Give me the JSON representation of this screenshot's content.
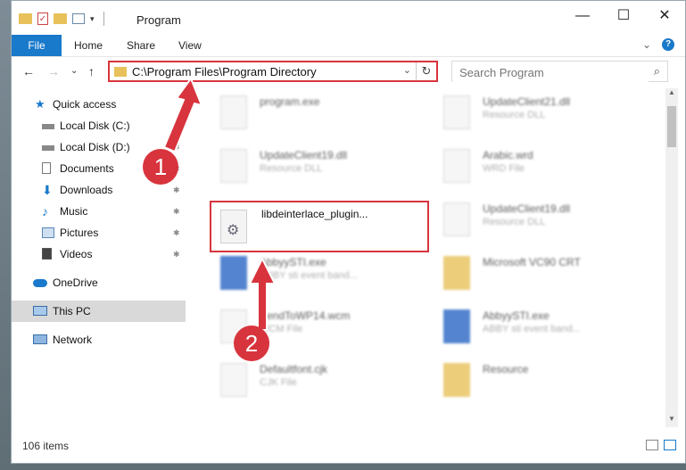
{
  "window": {
    "title": "Program",
    "controls": {
      "minimize": "—",
      "maximize": "☐",
      "close": "✕"
    }
  },
  "ribbon": {
    "tabs": [
      "File",
      "Home",
      "Share",
      "View"
    ],
    "expand": "⌄",
    "help": "?"
  },
  "nav": {
    "back": "←",
    "forward": "→",
    "recent": "⌄",
    "up": "↑",
    "address": "C:\\Program Files\\Program Directory",
    "refresh": "↻",
    "address_dropdown": "⌄"
  },
  "search": {
    "placeholder": "Search Program",
    "icon": "⌕"
  },
  "sidebar": {
    "items": [
      {
        "label": "Quick access",
        "icon": "star-icon",
        "pin": ""
      },
      {
        "label": "Local Disk (C:)",
        "icon": "drive-icon",
        "pin": ""
      },
      {
        "label": "Local Disk (D:)",
        "icon": "drive-icon",
        "pin": "✱"
      },
      {
        "label": "Documents",
        "icon": "documents-icon",
        "pin": "✱"
      },
      {
        "label": "Downloads",
        "icon": "downloads-icon",
        "pin": "✱"
      },
      {
        "label": "Music",
        "icon": "music-icon",
        "pin": "✱"
      },
      {
        "label": "Pictures",
        "icon": "pictures-icon",
        "pin": "✱"
      },
      {
        "label": "Videos",
        "icon": "videos-icon",
        "pin": "✱"
      },
      {
        "label": "OneDrive",
        "icon": "cloud-icon",
        "pin": ""
      },
      {
        "label": "This PC",
        "icon": "computer-icon",
        "pin": ""
      },
      {
        "label": "Network",
        "icon": "network-icon",
        "pin": ""
      }
    ]
  },
  "files": [
    {
      "name": "program.exe",
      "type": ""
    },
    {
      "name": "UpdateClient21.dll",
      "type": "Resource DLL"
    },
    {
      "name": "UpdateClient19.dll",
      "type": "Resource DLL"
    },
    {
      "name": "Arabic.wrd",
      "type": "WRD File"
    },
    {
      "name": "libdeinterlace_plugin...",
      "type": ""
    },
    {
      "name": "UpdateClient19.dll",
      "type": "Resource DLL"
    },
    {
      "name": "AbbyySTI.exe",
      "type": "ABBY sti event band..."
    },
    {
      "name": "Microsoft VC90 CRT",
      "type": ""
    },
    {
      "name": "SendToWP14.wcm",
      "type": "WCM File"
    },
    {
      "name": "AbbyySTI.exe",
      "type": "ABBY sti event band..."
    },
    {
      "name": "Defaultfont.cjk",
      "type": "CJK File"
    },
    {
      "name": "Resource",
      "type": ""
    }
  ],
  "status": {
    "items": "106 items"
  },
  "annotations": {
    "step1": "1",
    "step2": "2"
  },
  "colors": {
    "accent": "#1979ca",
    "highlight": "#d8343d"
  }
}
